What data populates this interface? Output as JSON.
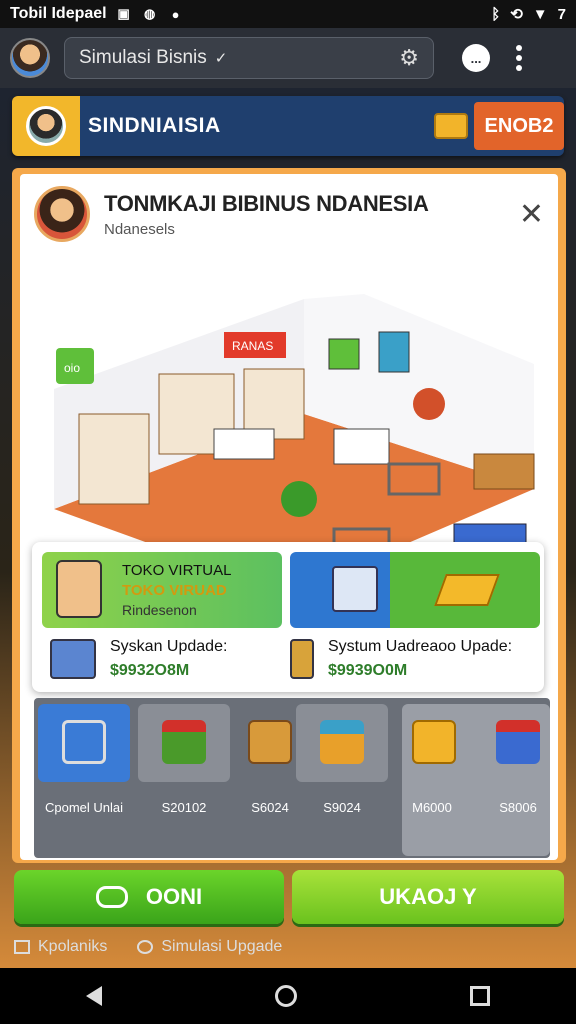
{
  "status_bar": {
    "left_text": "Tobil Idepael",
    "battery_text": "7"
  },
  "app_bar": {
    "search_text": "Simulasi Bisnis",
    "chat_text": "..."
  },
  "banner": {
    "title": "SINDNIAISIA",
    "button_label": "ENOB2"
  },
  "panel": {
    "title": "TONMKAJI BIBINUS NDANESIA",
    "subtitle": "Ndanesels",
    "scene_sign": "RANAS",
    "scene_tag": "oio"
  },
  "cards": [
    {
      "line1": "TOKO VIRTUAL",
      "line2": "TOKO VIRUAD",
      "line3": "Rindesenon"
    }
  ],
  "updates": [
    {
      "title": "Syskan Updade:",
      "price": "$9932O8M"
    },
    {
      "title": "Systum Uadreaoo Upade:",
      "price": "$9939O0M"
    }
  ],
  "shop_items": [
    {
      "label": "Cpomel Unlai",
      "icon": "cart-icon"
    },
    {
      "label": "S20102",
      "icon": "stamp-icon"
    },
    {
      "label": "S6024",
      "icon": "box-icon"
    },
    {
      "label": "S9024",
      "icon": "tractor-icon"
    },
    {
      "label": "M6000",
      "icon": "gift-icon"
    },
    {
      "label": "S8006",
      "icon": "plunger-icon"
    }
  ],
  "buttons": {
    "primary": "OONI",
    "secondary": "UKAOJ Y"
  },
  "footer": {
    "link1": "Kpolaniks",
    "link2": "Simulasi Upgade"
  },
  "colors": {
    "accent_orange": "#f5a84a",
    "green": "#5cc060",
    "blue": "#2e77d0"
  }
}
